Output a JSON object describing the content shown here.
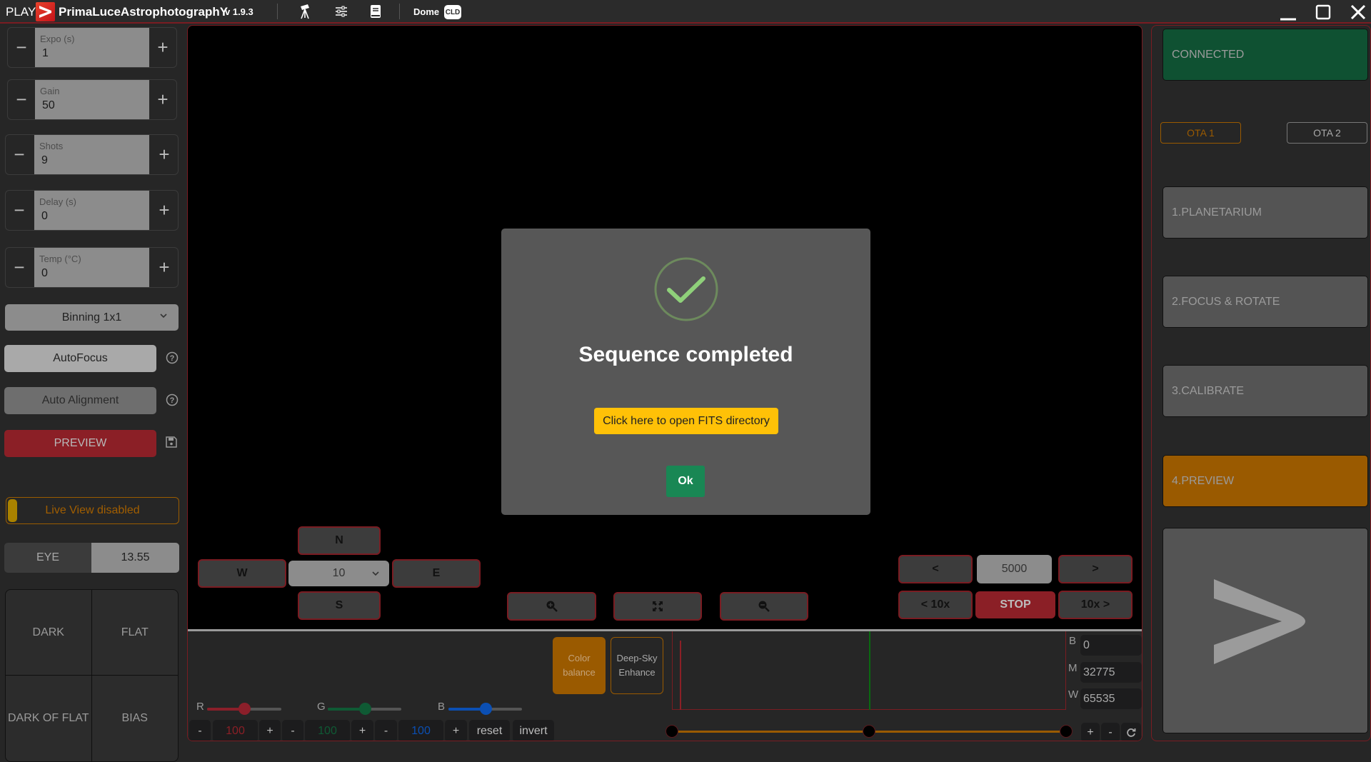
{
  "titlebar": {
    "play": "PLAY",
    "app_name": "PrimaLuceAstrophotographY",
    "version": "v 1.9.3",
    "dome_label": "Dome",
    "cld_badge": "CLD",
    "icons": [
      "telescope-icon",
      "sliders-icon",
      "book-icon"
    ],
    "window_controls": [
      "minimize-icon",
      "maximize-icon",
      "close-icon"
    ]
  },
  "left_panel": {
    "steppers": [
      {
        "label": "Expo (s)",
        "value": "1"
      },
      {
        "label": "Gain",
        "value": "50"
      },
      {
        "label": "Shots",
        "value": "9"
      },
      {
        "label": "Delay (s)",
        "value": "0"
      },
      {
        "label": "Temp (°C)",
        "value": "0"
      }
    ],
    "minus": "−",
    "plus": "+",
    "binning": "Binning 1x1",
    "autofocus": "AutoFocus",
    "auto_alignment": "Auto Alignment",
    "preview": "PREVIEW",
    "live_view": "Live View disabled",
    "eye_label": "EYE",
    "eye_value": "13.55",
    "calibration": [
      "DARK",
      "FLAT",
      "DARK OF FLAT",
      "BIAS"
    ]
  },
  "modal": {
    "title": "Sequence completed",
    "fits_button": "Click here to open FITS directory",
    "ok_button": "Ok"
  },
  "guide_pad": {
    "north": "N",
    "south": "S",
    "west": "W",
    "east": "E",
    "step": "10"
  },
  "focuser": {
    "back": "<",
    "forward": ">",
    "steps": "5000",
    "back10": "< 10x",
    "forward10": "10x >",
    "stop": "STOP"
  },
  "zoom_controls": [
    "zoom-in-icon",
    "fit-screen-icon",
    "zoom-out-icon"
  ],
  "color_balance": {
    "color_balance_btn": "Color balance",
    "color_balance_l1": "Color",
    "color_balance_l2": "balance",
    "deep_sky_l1": "Deep-Sky",
    "deep_sky_l2": "Enhance",
    "r_label": "R",
    "g_label": "G",
    "b_label": "B",
    "r_value": "100",
    "g_value": "100",
    "b_value": "100",
    "r_fraction": 0.5,
    "g_fraction": 0.5,
    "b_fraction": 0.5,
    "minus": "-",
    "plus": "+",
    "reset": "reset",
    "invert": "invert",
    "colors": {
      "r": "#8b1f2a",
      "g": "#0f5a34",
      "b": "#0b4fb3"
    }
  },
  "histogram": {
    "black_label": "B",
    "mid_label": "M",
    "white_label": "W",
    "black": "0",
    "mid": "32775",
    "white": "65535",
    "plus": "+",
    "minus": "-",
    "black_fraction": 0.0,
    "mid_fraction": 0.5,
    "white_fraction": 1.0
  },
  "right_panel": {
    "status": "CONNECTED",
    "ota1": "OTA 1",
    "ota2": "OTA 2",
    "steps": [
      "1.PLANETARIUM",
      "2.FOCUS & ROTATE",
      "3.CALIBRATE",
      "4.PREVIEW"
    ],
    "active_step": 3,
    "start_symbol": ">",
    "colors": {
      "connected": "#0f5132",
      "active": "#9a5a00",
      "inactive": "#545454"
    }
  }
}
